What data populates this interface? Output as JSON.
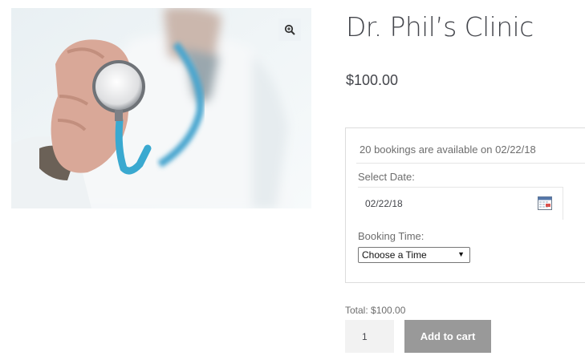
{
  "product": {
    "title": "Dr. Phil’s Clinic",
    "price": "$100.00",
    "image_alt": "doctor-holding-stethoscope"
  },
  "booking": {
    "availability_text": "20 bookings are available on 02/22/18",
    "select_date_label": "Select Date:",
    "date_value": "02/22/18",
    "booking_time_label": "Booking Time:",
    "time_select_value": "Choose a Time"
  },
  "cart": {
    "total_text": "Total: $100.00",
    "quantity": "1",
    "add_to_cart_label": "Add to cart"
  },
  "icons": {
    "zoom": "zoom-in-icon",
    "calendar": "calendar-icon"
  },
  "colors": {
    "title": "#43454b",
    "button_bg": "#999999",
    "stethoscope_tube": "#3aa9d0"
  }
}
